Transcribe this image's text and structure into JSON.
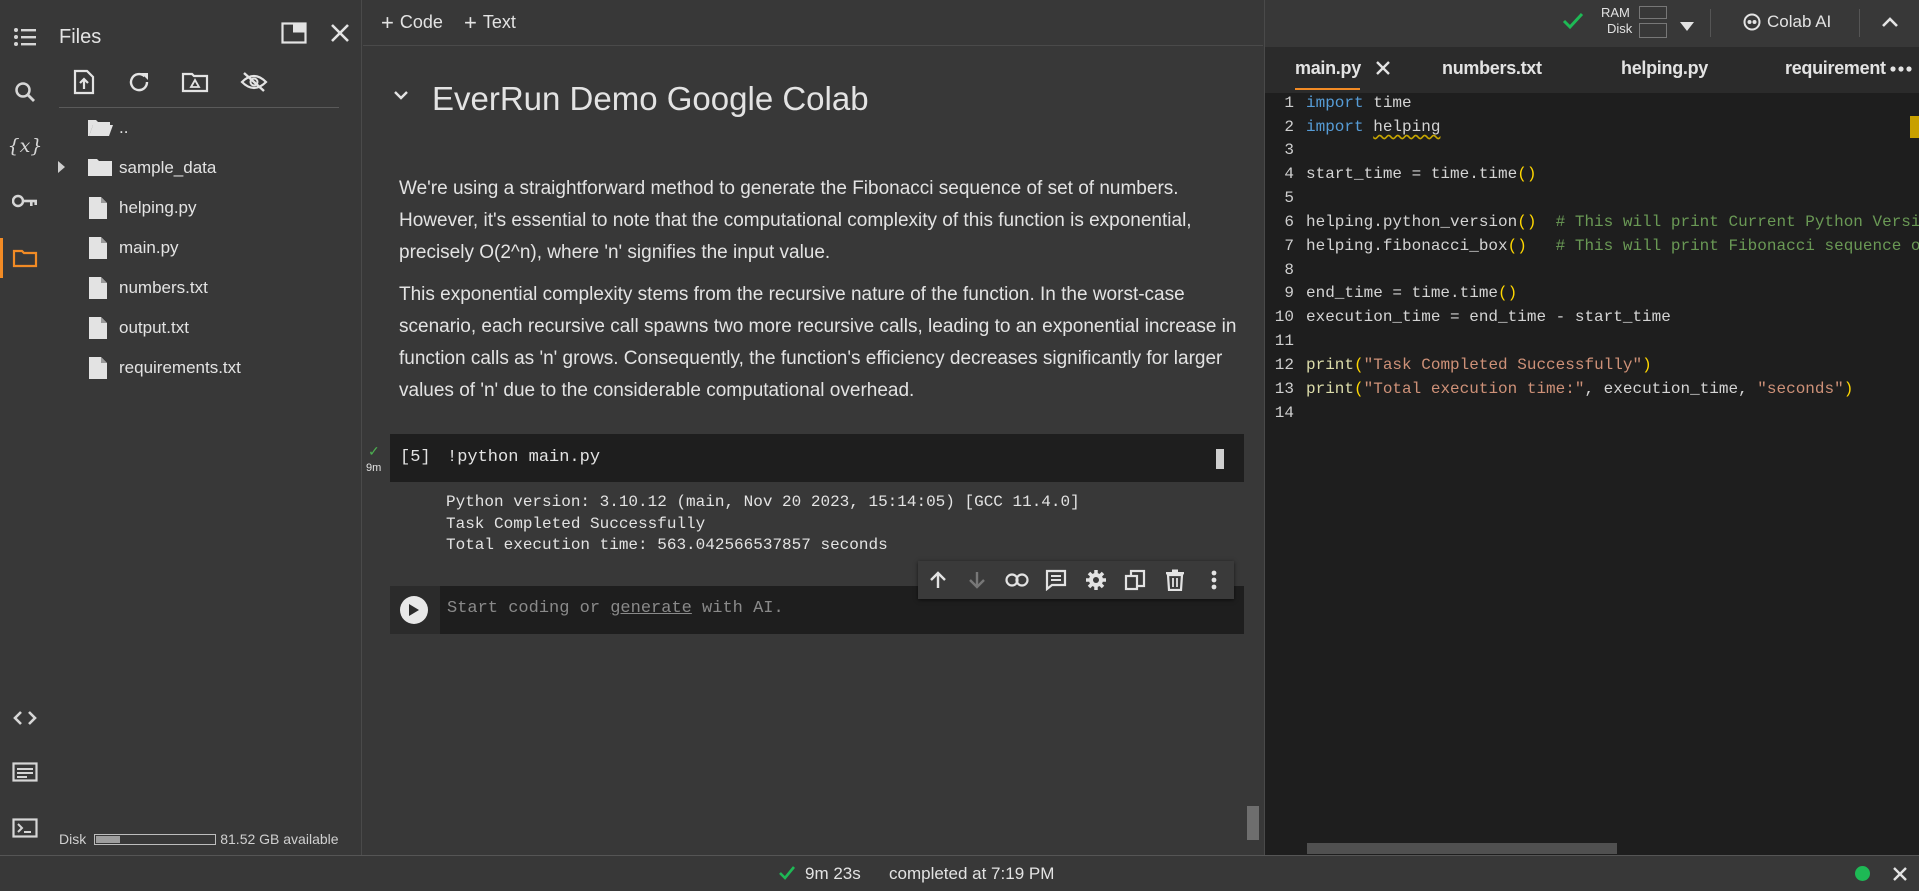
{
  "files_panel": {
    "title": "Files",
    "items": [
      {
        "label": ".."
      },
      {
        "label": "sample_data"
      },
      {
        "label": "helping.py"
      },
      {
        "label": "main.py"
      },
      {
        "label": "numbers.txt"
      },
      {
        "label": "output.txt"
      },
      {
        "label": "requirements.txt"
      }
    ],
    "disk_label": "Disk",
    "disk_available": "81.52 GB available",
    "disk_used_fraction": 0.2
  },
  "toolbar": {
    "code_label": "Code",
    "text_label": "Text",
    "ram_label": "RAM",
    "disk_label": "Disk",
    "colab_ai_label": "Colab AI"
  },
  "notebook": {
    "section_title": "EverRun Demo Google Colab",
    "paragraph1": "We're using a straightforward method to generate the Fibonacci sequence of set of numbers. However, it's essential to note that the computational complexity of this function is exponential, precisely O(2^n), where 'n' signifies the input value.",
    "paragraph2": "This exponential complexity stems from the recursive nature of the function. In the worst-case scenario, each recursive call spawns two more recursive calls, leading to an exponential increase in function calls as 'n' grows. Consequently, the function's efficiency decreases significantly for larger values of 'n' due to the considerable computational overhead.",
    "cell": {
      "exec_time": "9m",
      "exec_count": "[5]",
      "code": "!python main.py",
      "output": [
        "Python version: 3.10.12 (main, Nov 20 2023, 15:14:05) [GCC 11.4.0]",
        "Task Completed Successfully",
        "Total execution time: 563.042566537857 seconds"
      ]
    },
    "empty_cell": {
      "placeholder_before": "Start coding or ",
      "placeholder_link": "generate",
      "placeholder_after": " with AI."
    }
  },
  "editor": {
    "tabs": [
      {
        "label": "main.py",
        "active": true
      },
      {
        "label": "numbers.txt",
        "active": false
      },
      {
        "label": "helping.py",
        "active": false
      },
      {
        "label": "requirement",
        "active": false
      }
    ],
    "line_numbers": [
      "1",
      "2",
      "3",
      "4",
      "5",
      "6",
      "7",
      "8",
      "9",
      "10",
      "11",
      "12",
      "13",
      "14"
    ],
    "code_tokens": {
      "l1_kw": "import",
      "l1_rest": " time",
      "l2_kw": "import",
      "l2_rest": "helping",
      "l4_a": "start_time = time.time",
      "l4_p": "()",
      "l6_a": "helping.python_version",
      "l6_p": "()",
      "l6_c": "  # This will print Current Python Version",
      "l7_a": "helping.fibonacci_box",
      "l7_p": "()",
      "l7_c": "   # This will print Fibonacci sequence of",
      "l9_a": "end_time = time.time",
      "l9_p": "()",
      "l10": "execution_time = end_time - start_time",
      "l12_fn": "print",
      "l12_p1": "(",
      "l12_s": "\"Task Completed Successfully\"",
      "l12_p2": ")",
      "l13_fn": "print",
      "l13_p1": "(",
      "l13_s1": "\"Total execution time:\"",
      "l13_mid": ", execution_time, ",
      "l13_s2": "\"seconds\"",
      "l13_p2": ")"
    }
  },
  "statusbar": {
    "elapsed": "9m 23s",
    "completed": "completed at 7:19 PM"
  },
  "colors": {
    "accent": "#f28b25",
    "success": "#1eb955"
  }
}
